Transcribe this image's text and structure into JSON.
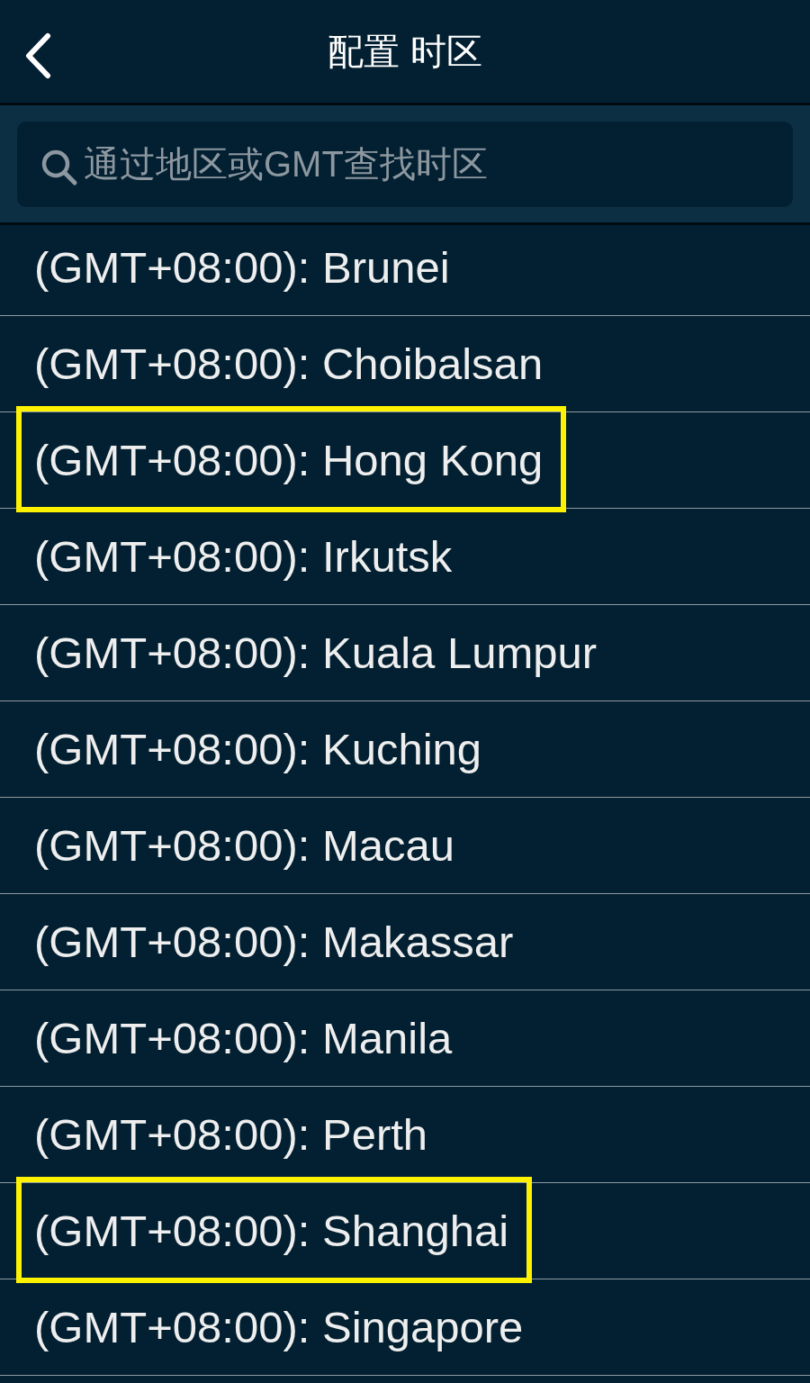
{
  "header": {
    "title": "配置 时区"
  },
  "search": {
    "placeholder": "通过地区或GMT查找时区"
  },
  "rows": [
    {
      "label": "(GMT+08:00): Brunei",
      "highlighted": false
    },
    {
      "label": "(GMT+08:00): Choibalsan",
      "highlighted": false
    },
    {
      "label": "(GMT+08:00): Hong Kong",
      "highlighted": true
    },
    {
      "label": "(GMT+08:00): Irkutsk",
      "highlighted": false
    },
    {
      "label": "(GMT+08:00): Kuala Lumpur",
      "highlighted": false
    },
    {
      "label": "(GMT+08:00): Kuching",
      "highlighted": false
    },
    {
      "label": "(GMT+08:00): Macau",
      "highlighted": false
    },
    {
      "label": "(GMT+08:00): Makassar",
      "highlighted": false
    },
    {
      "label": "(GMT+08:00): Manila",
      "highlighted": false
    },
    {
      "label": "(GMT+08:00): Perth",
      "highlighted": false
    },
    {
      "label": "(GMT+08:00): Shanghai",
      "highlighted": true
    },
    {
      "label": "(GMT+08:00): Singapore",
      "highlighted": false
    }
  ]
}
